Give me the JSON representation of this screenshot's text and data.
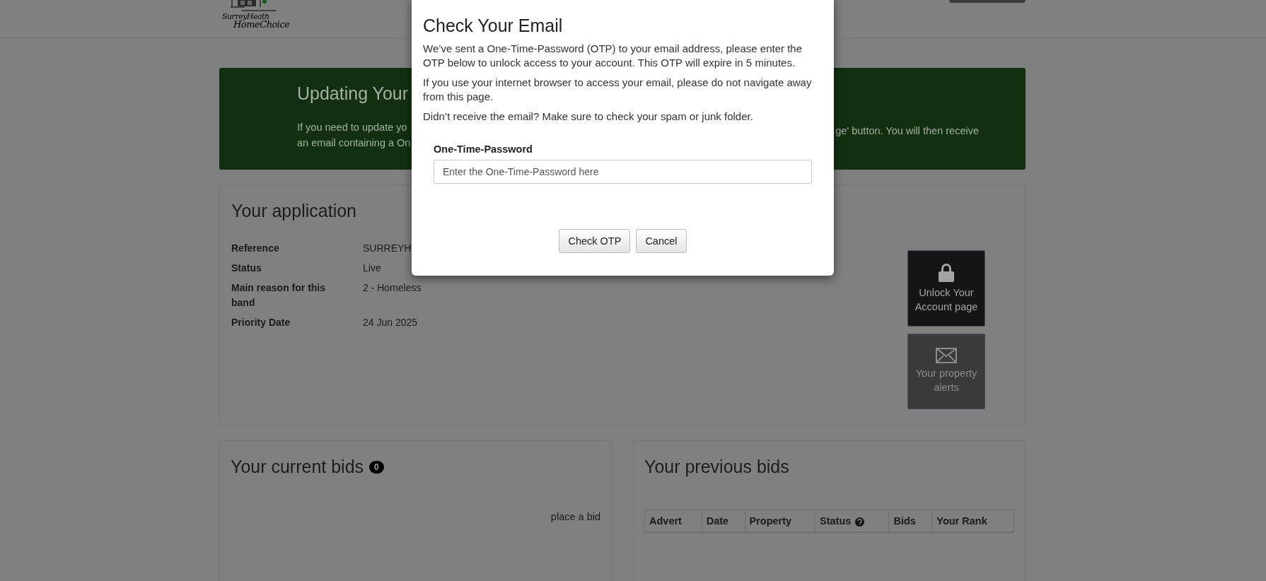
{
  "header": {
    "logo": {
      "line1": "SurreyHeath",
      "line2": "HomeChoice"
    }
  },
  "banner": {
    "title": "Updating Your",
    "left_lines": [
      "If you need to update yo",
      "an email containing a On"
    ],
    "right_lines": [
      "ge' button. You will then receive"
    ]
  },
  "application": {
    "title": "Your application",
    "rows": [
      {
        "label": "Reference",
        "value": "SURREYH"
      },
      {
        "label": "Status",
        "value": "Live"
      },
      {
        "label": "Main reason for this band",
        "value": "2 - Homeless"
      },
      {
        "label": "Priority Date",
        "value": "24 Jun 2025"
      }
    ],
    "actions": [
      {
        "kind": "unlock",
        "label": "Unlock Your Account page"
      },
      {
        "kind": "alerts",
        "label": "Your property alerts"
      }
    ]
  },
  "current_bids": {
    "title": "Your current bids",
    "count": "0",
    "link": "place a bid"
  },
  "previous_bids": {
    "title": "Your previous bids",
    "columns": [
      {
        "label": "Advert",
        "help": false
      },
      {
        "label": "Date",
        "help": false
      },
      {
        "label": "Property",
        "help": false
      },
      {
        "label": "Status",
        "help": true
      },
      {
        "label": "Bids",
        "help": false
      },
      {
        "label": "Your Rank",
        "help": false
      }
    ]
  },
  "dialog": {
    "title": "Check Your Email",
    "paragraphs": [
      "We’ve sent a One-Time-Password (OTP) to your email address, please enter the OTP below to unlock access to your account. This OTP will expire in 5 minutes.",
      "If you use your internet browser to access your email, please do not navigate away from this page.",
      "Didn’t receive the email? Make sure to check your spam or junk folder."
    ],
    "field": {
      "label": "One-Time-Password",
      "placeholder": "Enter the One-Time-Password here"
    },
    "buttons": [
      "Check OTP",
      "Cancel"
    ]
  }
}
